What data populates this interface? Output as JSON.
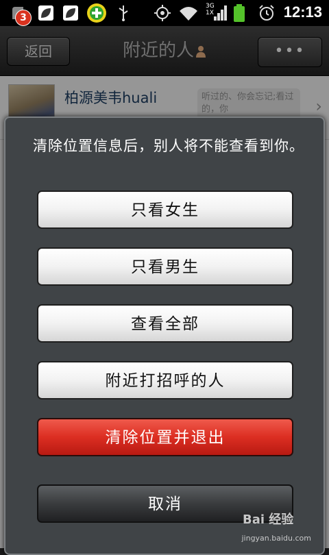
{
  "status_bar": {
    "notification_count": "3",
    "network_label_top": "3G",
    "network_label_bottom": "1X",
    "time": "12:13",
    "icons": [
      "notification-icon",
      "leaf-app-icon",
      "leaf-app-icon",
      "plus-app-icon",
      "usb-icon",
      "gps-icon",
      "wifi-icon",
      "signal-icon",
      "battery-icon",
      "alarm-icon"
    ]
  },
  "header": {
    "back_label": "返回",
    "title": "附近的人",
    "more_label": "•••"
  },
  "list": {
    "items": [
      {
        "name": "柏源美韦huali",
        "signature": "听过的、你会忘记;看过的，你"
      }
    ]
  },
  "dialog": {
    "message": "清除位置信息后，别人将不能查看到你。",
    "buttons": [
      {
        "label": "只看女生"
      },
      {
        "label": "只看男生"
      },
      {
        "label": "查看全部"
      },
      {
        "label": "附近打招呼的人"
      },
      {
        "label": "清除位置并退出"
      },
      {
        "label": "取消"
      }
    ]
  },
  "watermark": {
    "brand": "Bai 经验",
    "url": "jingyan.baidu.com"
  },
  "colors": {
    "danger": "#dc2e22",
    "dialog_bg": "#404447",
    "status_bar": "#000000"
  }
}
